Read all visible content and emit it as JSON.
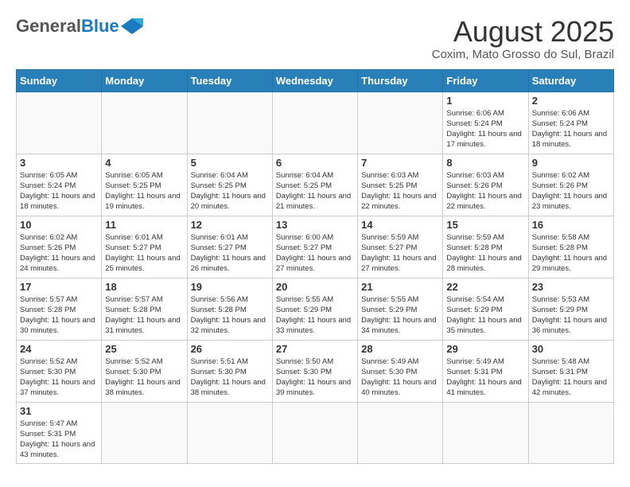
{
  "header": {
    "logo_general": "General",
    "logo_blue": "Blue",
    "month_title": "August 2025",
    "subtitle": "Coxim, Mato Grosso do Sul, Brazil"
  },
  "days_of_week": [
    "Sunday",
    "Monday",
    "Tuesday",
    "Wednesday",
    "Thursday",
    "Friday",
    "Saturday"
  ],
  "weeks": [
    [
      {
        "day": "",
        "info": ""
      },
      {
        "day": "",
        "info": ""
      },
      {
        "day": "",
        "info": ""
      },
      {
        "day": "",
        "info": ""
      },
      {
        "day": "",
        "info": ""
      },
      {
        "day": "1",
        "info": "Sunrise: 6:06 AM\nSunset: 5:24 PM\nDaylight: 11 hours\nand 17 minutes."
      },
      {
        "day": "2",
        "info": "Sunrise: 6:06 AM\nSunset: 5:24 PM\nDaylight: 11 hours\nand 18 minutes."
      }
    ],
    [
      {
        "day": "3",
        "info": "Sunrise: 6:05 AM\nSunset: 5:24 PM\nDaylight: 11 hours\nand 18 minutes."
      },
      {
        "day": "4",
        "info": "Sunrise: 6:05 AM\nSunset: 5:25 PM\nDaylight: 11 hours\nand 19 minutes."
      },
      {
        "day": "5",
        "info": "Sunrise: 6:04 AM\nSunset: 5:25 PM\nDaylight: 11 hours\nand 20 minutes."
      },
      {
        "day": "6",
        "info": "Sunrise: 6:04 AM\nSunset: 5:25 PM\nDaylight: 11 hours\nand 21 minutes."
      },
      {
        "day": "7",
        "info": "Sunrise: 6:03 AM\nSunset: 5:25 PM\nDaylight: 11 hours\nand 22 minutes."
      },
      {
        "day": "8",
        "info": "Sunrise: 6:03 AM\nSunset: 5:26 PM\nDaylight: 11 hours\nand 22 minutes."
      },
      {
        "day": "9",
        "info": "Sunrise: 6:02 AM\nSunset: 5:26 PM\nDaylight: 11 hours\nand 23 minutes."
      }
    ],
    [
      {
        "day": "10",
        "info": "Sunrise: 6:02 AM\nSunset: 5:26 PM\nDaylight: 11 hours\nand 24 minutes."
      },
      {
        "day": "11",
        "info": "Sunrise: 6:01 AM\nSunset: 5:27 PM\nDaylight: 11 hours\nand 25 minutes."
      },
      {
        "day": "12",
        "info": "Sunrise: 6:01 AM\nSunset: 5:27 PM\nDaylight: 11 hours\nand 26 minutes."
      },
      {
        "day": "13",
        "info": "Sunrise: 6:00 AM\nSunset: 5:27 PM\nDaylight: 11 hours\nand 27 minutes."
      },
      {
        "day": "14",
        "info": "Sunrise: 5:59 AM\nSunset: 5:27 PM\nDaylight: 11 hours\nand 27 minutes."
      },
      {
        "day": "15",
        "info": "Sunrise: 5:59 AM\nSunset: 5:28 PM\nDaylight: 11 hours\nand 28 minutes."
      },
      {
        "day": "16",
        "info": "Sunrise: 5:58 AM\nSunset: 5:28 PM\nDaylight: 11 hours\nand 29 minutes."
      }
    ],
    [
      {
        "day": "17",
        "info": "Sunrise: 5:57 AM\nSunset: 5:28 PM\nDaylight: 11 hours\nand 30 minutes."
      },
      {
        "day": "18",
        "info": "Sunrise: 5:57 AM\nSunset: 5:28 PM\nDaylight: 11 hours\nand 31 minutes."
      },
      {
        "day": "19",
        "info": "Sunrise: 5:56 AM\nSunset: 5:28 PM\nDaylight: 11 hours\nand 32 minutes."
      },
      {
        "day": "20",
        "info": "Sunrise: 5:55 AM\nSunset: 5:29 PM\nDaylight: 11 hours\nand 33 minutes."
      },
      {
        "day": "21",
        "info": "Sunrise: 5:55 AM\nSunset: 5:29 PM\nDaylight: 11 hours\nand 34 minutes."
      },
      {
        "day": "22",
        "info": "Sunrise: 5:54 AM\nSunset: 5:29 PM\nDaylight: 11 hours\nand 35 minutes."
      },
      {
        "day": "23",
        "info": "Sunrise: 5:53 AM\nSunset: 5:29 PM\nDaylight: 11 hours\nand 36 minutes."
      }
    ],
    [
      {
        "day": "24",
        "info": "Sunrise: 5:52 AM\nSunset: 5:30 PM\nDaylight: 11 hours\nand 37 minutes."
      },
      {
        "day": "25",
        "info": "Sunrise: 5:52 AM\nSunset: 5:30 PM\nDaylight: 11 hours\nand 38 minutes."
      },
      {
        "day": "26",
        "info": "Sunrise: 5:51 AM\nSunset: 5:30 PM\nDaylight: 11 hours\nand 38 minutes."
      },
      {
        "day": "27",
        "info": "Sunrise: 5:50 AM\nSunset: 5:30 PM\nDaylight: 11 hours\nand 39 minutes."
      },
      {
        "day": "28",
        "info": "Sunrise: 5:49 AM\nSunset: 5:30 PM\nDaylight: 11 hours\nand 40 minutes."
      },
      {
        "day": "29",
        "info": "Sunrise: 5:49 AM\nSunset: 5:31 PM\nDaylight: 11 hours\nand 41 minutes."
      },
      {
        "day": "30",
        "info": "Sunrise: 5:48 AM\nSunset: 5:31 PM\nDaylight: 11 hours\nand 42 minutes."
      }
    ],
    [
      {
        "day": "31",
        "info": "Sunrise: 5:47 AM\nSunset: 5:31 PM\nDaylight: 11 hours\nand 43 minutes."
      },
      {
        "day": "",
        "info": ""
      },
      {
        "day": "",
        "info": ""
      },
      {
        "day": "",
        "info": ""
      },
      {
        "day": "",
        "info": ""
      },
      {
        "day": "",
        "info": ""
      },
      {
        "day": "",
        "info": ""
      }
    ]
  ]
}
